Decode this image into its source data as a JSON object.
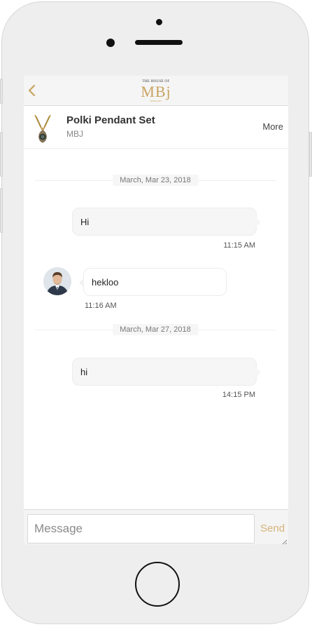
{
  "header": {
    "logo_top": "THE HOUSE OF",
    "logo_main": "MBj",
    "logo_sub": "SINCE 1877"
  },
  "product": {
    "title": "Polki Pendant Set",
    "subtitle": "MBJ",
    "more_label": "More"
  },
  "chat": {
    "messages": [
      {
        "date_separator": "March, Mar 23, 2018"
      },
      {
        "direction": "sent",
        "text": "Hi",
        "time": "11:15 AM"
      },
      {
        "direction": "received",
        "text": "hekloo",
        "time": "11:16 AM"
      },
      {
        "date_separator": "March, Mar 27, 2018"
      },
      {
        "direction": "sent",
        "text": "hi",
        "time": "14:15 PM"
      }
    ]
  },
  "compose": {
    "placeholder": "Message",
    "value": "",
    "send_label": "Send"
  },
  "colors": {
    "accent": "#c9a35f",
    "send": "#d6b37a",
    "bubble": "#f6f6f6",
    "frame": "#eeeeee"
  },
  "icons": [
    "back-chevron-icon",
    "pendant-thumbnail",
    "resize-grip-icon"
  ]
}
